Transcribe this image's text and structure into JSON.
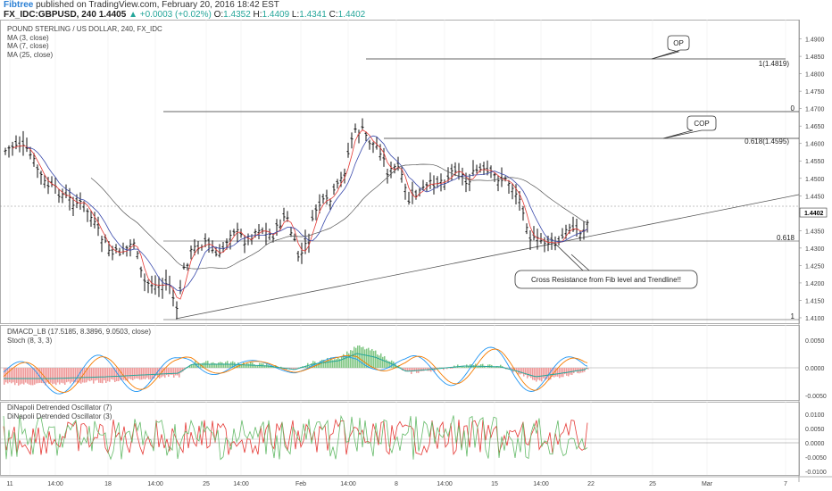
{
  "header": {
    "brand": "Fibtree",
    "published": "published on TradingView.com, February 20, 2016 18:42 EST"
  },
  "quote": {
    "symbol": "FX_IDC:GBPUSD, 240",
    "last": "1.4405",
    "change": "+0.0003 (+0.02%)",
    "open_label": "O:",
    "open": "1.4352",
    "high_label": "H:",
    "high": "1.4409",
    "low_label": "L:",
    "low": "1.4341",
    "close_label": "C:",
    "close": "1.4402"
  },
  "legend": {
    "instrument": "POUND STERLING / US DOLLAR, 240, FX_IDC",
    "ma1": "MA (3, close)",
    "ma2": "MA (7, close)",
    "ma3": "MA (25, close)"
  },
  "colors": {
    "ma3": "#e53935",
    "ma7": "#3949ab",
    "ma25": "#555555",
    "macd_line": "#2196f3",
    "signal_line": "#f57c00",
    "hist_pos": "#81c784",
    "hist_neg": "#ef9a9a",
    "stoch": "#26a69a",
    "osc7": "#e53935",
    "osc3": "#66bb6a"
  },
  "annotations": {
    "op": "OP",
    "cop": "COP",
    "fib_100": "1(1.4819)",
    "fib_0": "0",
    "fib_618_cop": "0.618(1.4595)",
    "fib_618": "0.618",
    "fib_1": "1",
    "callout": "Cross Resistance from Fib level and Trendline!!"
  },
  "price_axis": {
    "ticks": [
      "1.4900",
      "1.4800",
      "1.4700",
      "1.4600",
      "1.4500",
      "1.4400",
      "1.4300",
      "1.4200",
      "1.4100"
    ],
    "ticks_minor": [
      "1.4850",
      "1.4750",
      "1.4650",
      "1.4550",
      "1.4450",
      "1.4350",
      "1.4250",
      "1.4150"
    ],
    "current": "1.4402"
  },
  "macd_pane": {
    "label1": "DMACD_LB (17.5185, 8.3896, 9.0503, close)",
    "label2": "Stoch (8, 3, 3)",
    "ticks": [
      "0.0050",
      "0.0000",
      "-0.0050"
    ]
  },
  "osc_pane": {
    "label1": "DiNapoli Detrended Oscillator (7)",
    "label2": "DiNapoli Detrended Oscillator (3)",
    "ticks": [
      "0.0100",
      "0.0050",
      "0.0000",
      "-0.0050",
      "-0.0100"
    ]
  },
  "time_axis": [
    "11",
    "14:00",
    "18",
    "14:00",
    "25",
    "14:00",
    "Feb",
    "14:00",
    "8",
    "14:00",
    "15",
    "14:00",
    "22",
    "25",
    "Mar",
    "7"
  ],
  "chart_data": {
    "type": "candlestick",
    "series": [
      {
        "name": "GBPUSD",
        "values": []
      },
      {
        "name": "MA (3, close)",
        "values": []
      },
      {
        "name": "MA (7, close)",
        "values": []
      },
      {
        "name": "MA (25, close)",
        "values": []
      }
    ],
    "ylim": [
      1.4075,
      1.4945
    ],
    "fib_levels": [
      {
        "label": "1(1.4819)",
        "value": 1.4819
      },
      {
        "label": "0",
        "value": 1.4675
      },
      {
        "label": "0.618(1.4595)",
        "value": 1.4595
      },
      {
        "label": "0.618",
        "value": 1.431
      },
      {
        "label": "1",
        "value": 1.4085
      }
    ],
    "trendline": [
      [
        1.4085,
        "Jan 22"
      ],
      [
        1.4405,
        "Feb 21"
      ]
    ],
    "current_price": 1.4402
  }
}
